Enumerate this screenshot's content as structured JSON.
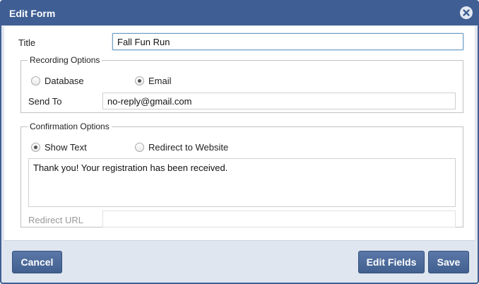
{
  "dialog": {
    "title": "Edit Form",
    "close_icon": "close-circle-icon"
  },
  "form": {
    "title_label": "Title",
    "title_value": "Fall Fun Run",
    "recording": {
      "legend": "Recording Options",
      "option_database": "Database",
      "option_email": "Email",
      "selected": "Email",
      "send_to_label": "Send To",
      "send_to_value": "no-reply@gmail.com"
    },
    "confirmation": {
      "legend": "Confirmation Options",
      "option_show_text": "Show Text",
      "option_redirect": "Redirect to Website",
      "selected": "Show Text",
      "message": "Thank you! Your registration has been received.",
      "redirect_url_label": "Redirect URL",
      "redirect_url_value": ""
    }
  },
  "buttons": {
    "cancel": "Cancel",
    "edit_fields": "Edit Fields",
    "save": "Save"
  },
  "colors": {
    "titlebar": "#3f5f94",
    "button": "#4a6899",
    "footer_bg": "#dfe6ef"
  }
}
